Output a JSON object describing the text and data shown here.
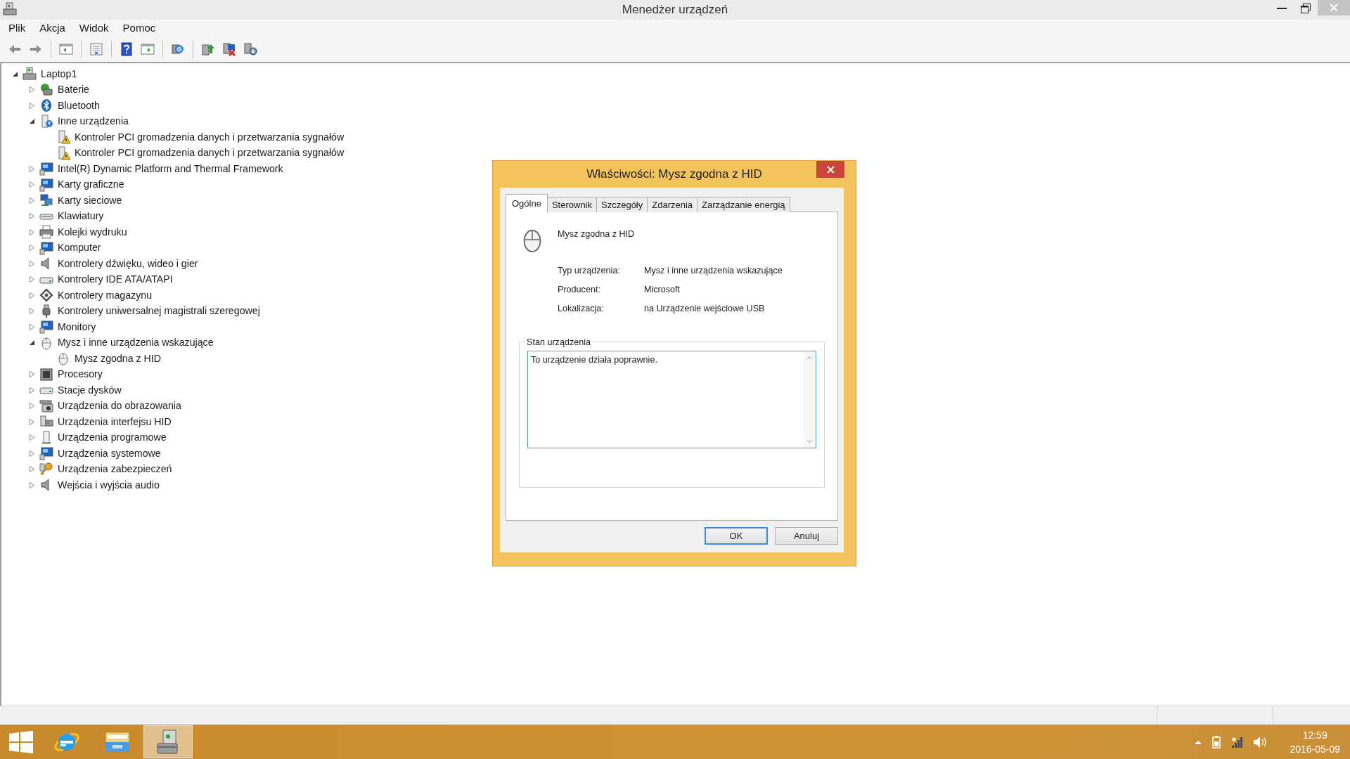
{
  "window": {
    "title": "Menedżer urządzeń"
  },
  "menu": [
    "Plik",
    "Akcja",
    "Widok",
    "Pomoc"
  ],
  "tree": {
    "label": "Laptop1",
    "kind": "computer",
    "expanded": true,
    "children": [
      {
        "label": "Baterie",
        "kind": "battery",
        "expanded": false
      },
      {
        "label": "Bluetooth",
        "kind": "bluetooth",
        "expanded": false
      },
      {
        "label": "Inne urządzenia",
        "kind": "unknown",
        "expanded": true,
        "children": [
          {
            "label": "Kontroler PCI gromadzenia danych i przetwarzania sygnałów",
            "kind": "warning"
          },
          {
            "label": "Kontroler PCI gromadzenia danych i przetwarzania sygnałów",
            "kind": "warning"
          }
        ]
      },
      {
        "label": "Intel(R) Dynamic Platform and Thermal Framework",
        "kind": "monitor",
        "expanded": false
      },
      {
        "label": "Karty graficzne",
        "kind": "monitor",
        "expanded": false
      },
      {
        "label": "Karty sieciowe",
        "kind": "network",
        "expanded": false
      },
      {
        "label": "Klawiatury",
        "kind": "keyboard",
        "expanded": false
      },
      {
        "label": "Kolejki wydruku",
        "kind": "printer",
        "expanded": false
      },
      {
        "label": "Komputer",
        "kind": "monitor",
        "expanded": false
      },
      {
        "label": "Kontrolery dźwięku, wideo i gier",
        "kind": "speaker",
        "expanded": false
      },
      {
        "label": "Kontrolery IDE ATA/ATAPI",
        "kind": "drive",
        "expanded": false
      },
      {
        "label": "Kontrolery magazynu",
        "kind": "storage",
        "expanded": false
      },
      {
        "label": "Kontrolery uniwersalnej magistrali szeregowej",
        "kind": "usb",
        "expanded": false
      },
      {
        "label": "Monitory",
        "kind": "monitor",
        "expanded": false
      },
      {
        "label": "Mysz i inne urządzenia wskazujące",
        "kind": "mouse",
        "expanded": true,
        "children": [
          {
            "label": "Mysz zgodna z HID",
            "kind": "mouse"
          }
        ]
      },
      {
        "label": "Procesory",
        "kind": "chip",
        "expanded": false
      },
      {
        "label": "Stacje dysków",
        "kind": "drive",
        "expanded": false
      },
      {
        "label": "Urządzenia do obrazowania",
        "kind": "camera",
        "expanded": false
      },
      {
        "label": "Urządzenia interfejsu HID",
        "kind": "hid",
        "expanded": false
      },
      {
        "label": "Urządzenia programowe",
        "kind": "device",
        "expanded": false
      },
      {
        "label": "Urządzenia systemowe",
        "kind": "monitor",
        "expanded": false
      },
      {
        "label": "Urządzenia zabezpieczeń",
        "kind": "key",
        "expanded": false
      },
      {
        "label": "Wejścia i wyjścia audio",
        "kind": "speaker",
        "expanded": false
      }
    ]
  },
  "dialog": {
    "title": "Właściwości: Mysz zgodna z HID",
    "tabs": [
      {
        "label": "Ogólne",
        "selected": true
      },
      {
        "label": "Sterownik",
        "selected": false
      },
      {
        "label": "Szczegóły",
        "selected": false
      },
      {
        "label": "Zdarzenia",
        "selected": false
      },
      {
        "label": "Zarządzanie energią",
        "selected": false
      }
    ],
    "device": {
      "kind": "mouse",
      "name": "Mysz zgodna z HID"
    },
    "properties": [
      {
        "label": "Typ urządzenia:",
        "value": "Mysz i inne urządzenia wskazujące"
      },
      {
        "label": "Producent:",
        "value": "Microsoft"
      },
      {
        "label": "Lokalizacja:",
        "value": "na Urządzenie wejściowe USB"
      }
    ],
    "status": {
      "label": "Stan urządzenia",
      "text": "To urządzenie działa poprawnie."
    },
    "buttons": [
      {
        "label": "OK",
        "default": true
      },
      {
        "label": "Anuluj",
        "default": false
      }
    ]
  },
  "taskbar": {
    "apps": [
      {
        "kind": "browser",
        "selected": false
      },
      {
        "kind": "folder",
        "selected": false
      },
      {
        "kind": "device-manager",
        "selected": true
      }
    ],
    "clock": {
      "time": "12:59",
      "date": "2016-05-09"
    }
  }
}
